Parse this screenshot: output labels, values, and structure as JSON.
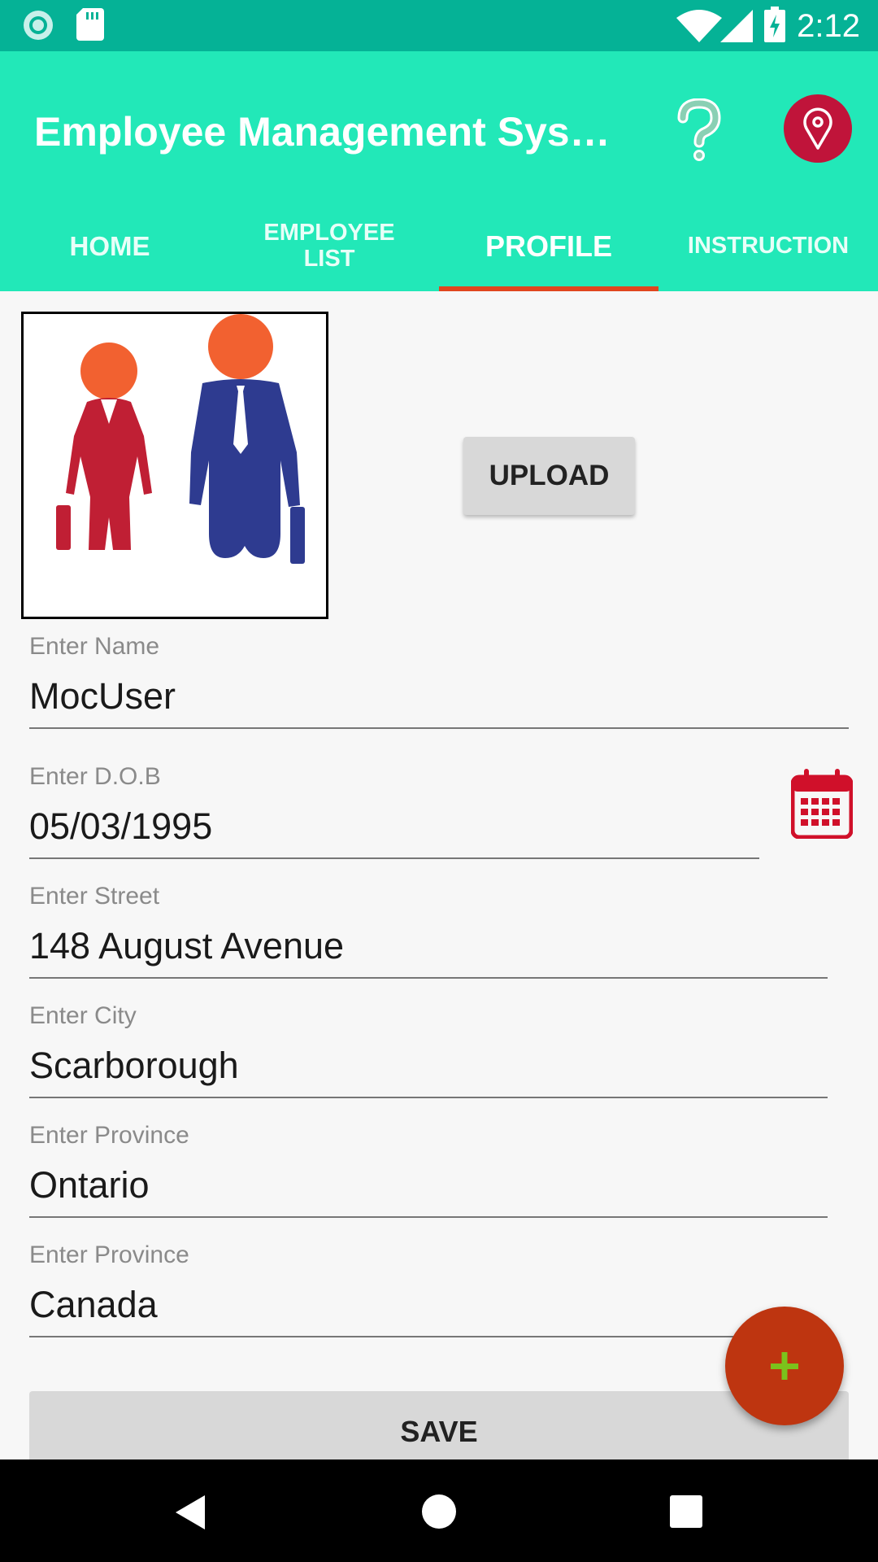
{
  "status_bar": {
    "time": "2:12",
    "icons": [
      "notification-icon",
      "sd-card-icon",
      "wifi-icon",
      "signal-icon",
      "battery-charging-icon"
    ]
  },
  "app_bar": {
    "title": "Employee Management System",
    "help_icon": "help-icon",
    "location_icon": "location-pin-icon"
  },
  "tabs": [
    {
      "label": "HOME",
      "active": false
    },
    {
      "label": "EMPLOYEE LIST",
      "active": false
    },
    {
      "label": "PROFILE",
      "active": true
    },
    {
      "label": "INSTRUCTION",
      "active": false
    }
  ],
  "profile": {
    "photo_alt": "employee-couple-image",
    "upload_label": "UPLOAD",
    "name": {
      "label": "Enter Name",
      "value": "MocUser"
    },
    "dob": {
      "label": "Enter D.O.B",
      "value": "05/03/1995"
    },
    "street": {
      "label": "Enter Street",
      "value": "148 August Avenue"
    },
    "city": {
      "label": "Enter City",
      "value": "Scarborough"
    },
    "province": {
      "label": "Enter Province",
      "value": "Ontario"
    },
    "country": {
      "label": "Enter Province",
      "value": "Canada"
    },
    "save_label": "SAVE"
  },
  "fab": {
    "icon": "plus-icon"
  },
  "nav_bar": {
    "icons": [
      "back-icon",
      "home-icon",
      "recents-icon"
    ]
  },
  "colors": {
    "status_bar": "#05b296",
    "app_bar": "#22e8b8",
    "tab_indicator": "#e0461e",
    "fab": "#be3510",
    "fab_plus": "#7bc21c",
    "location_button": "#c0143a",
    "calendar": "#d0102a"
  }
}
